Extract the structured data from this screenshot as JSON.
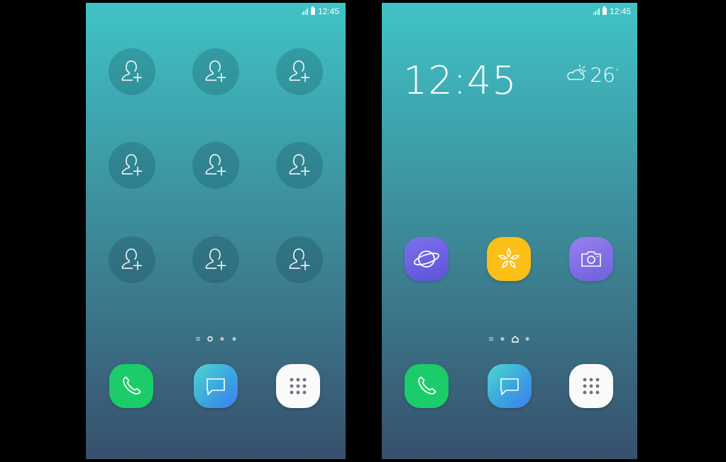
{
  "status_bar": {
    "time": "12:45"
  },
  "left_screen": {
    "contact_slots": [
      {
        "icon": "add-contact-icon"
      },
      {
        "icon": "add-contact-icon"
      },
      {
        "icon": "add-contact-icon"
      },
      {
        "icon": "add-contact-icon"
      },
      {
        "icon": "add-contact-icon"
      },
      {
        "icon": "add-contact-icon"
      },
      {
        "icon": "add-contact-icon"
      },
      {
        "icon": "add-contact-icon"
      },
      {
        "icon": "add-contact-icon"
      }
    ],
    "page_indicator": {
      "active_page": 1,
      "pages": 3
    }
  },
  "right_screen": {
    "clock": "12:45",
    "weather": {
      "icon": "partly-cloudy-icon",
      "temperature": "26",
      "unit": "°"
    },
    "apps": [
      {
        "icon": "internet-icon",
        "color": "#6a60e2"
      },
      {
        "icon": "gallery-icon",
        "color": "#fbbf18"
      },
      {
        "icon": "camera-icon",
        "color": "#7f6ee6"
      }
    ],
    "page_indicator": {
      "active_page": "home",
      "pages": 3
    }
  },
  "dock": [
    {
      "icon": "phone-icon",
      "color": "#1ccc6a"
    },
    {
      "icon": "messages-icon",
      "color": "#3aa5e0"
    },
    {
      "icon": "apps-grid-icon",
      "color": "#fafafa"
    }
  ],
  "colors": {
    "wallpaper_top": "#40c3c6",
    "wallpaper_bottom": "#37506c"
  }
}
